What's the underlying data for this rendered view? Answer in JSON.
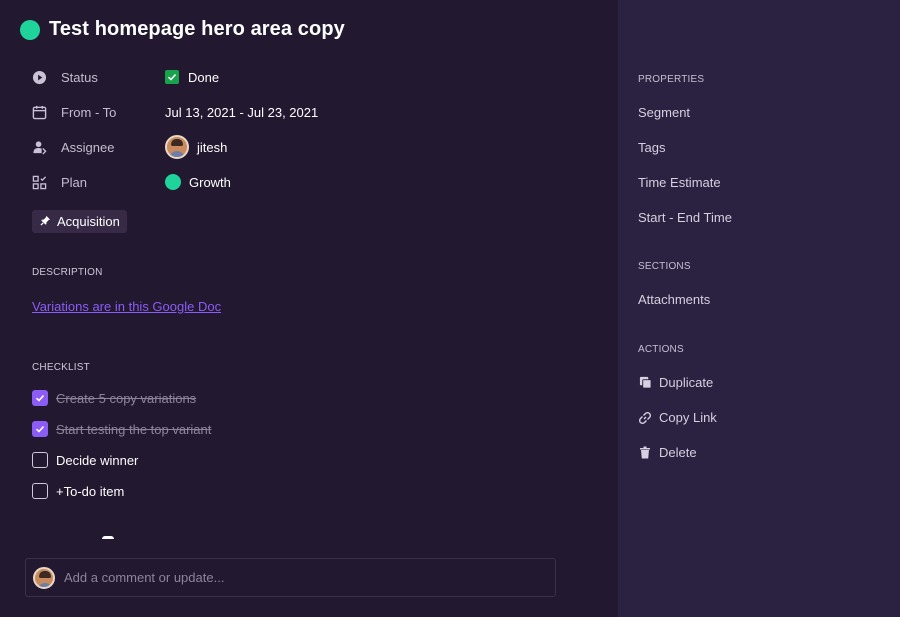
{
  "task": {
    "title": "Test homepage hero area copy",
    "status_color": "#1fd49a"
  },
  "properties": {
    "status": {
      "label": "Status",
      "value": "Done",
      "icon": "status-play-icon"
    },
    "dates": {
      "label": "From - To",
      "value": "Jul 13, 2021 - Jul 23, 2021",
      "icon": "calendar-icon"
    },
    "assignee": {
      "label": "Assignee",
      "value": "jitesh",
      "icon": "assignee-icon"
    },
    "plan": {
      "label": "Plan",
      "value": "Growth",
      "icon": "plan-icon",
      "color": "#1fd49a"
    }
  },
  "tag": {
    "label": "Acquisition",
    "icon": "pin-icon"
  },
  "description": {
    "heading": "DESCRIPTION",
    "link_text": "Variations are in this Google Doc"
  },
  "checklist": {
    "heading": "CHECKLIST",
    "items": [
      {
        "text": "Create 5 copy variations",
        "done": true
      },
      {
        "text": "Start testing the top variant",
        "done": true
      },
      {
        "text": "Decide winner",
        "done": false
      },
      {
        "text": "+To-do item",
        "done": false
      }
    ]
  },
  "comment": {
    "placeholder": "Add a comment or update..."
  },
  "sidebar": {
    "properties_heading": "PROPERTIES",
    "properties": [
      "Segment",
      "Tags",
      "Time Estimate",
      "Start - End Time"
    ],
    "sections_heading": "SECTIONS",
    "sections": [
      "Attachments"
    ],
    "actions_heading": "ACTIONS",
    "actions": [
      {
        "label": "Duplicate",
        "icon": "duplicate-icon"
      },
      {
        "label": "Copy Link",
        "icon": "link-icon"
      },
      {
        "label": "Delete",
        "icon": "trash-icon"
      }
    ]
  },
  "colors": {
    "accent": "#8b5cf6",
    "done_green": "#16a34a",
    "main_bg": "#221830",
    "sidebar_bg": "#2b2140"
  }
}
